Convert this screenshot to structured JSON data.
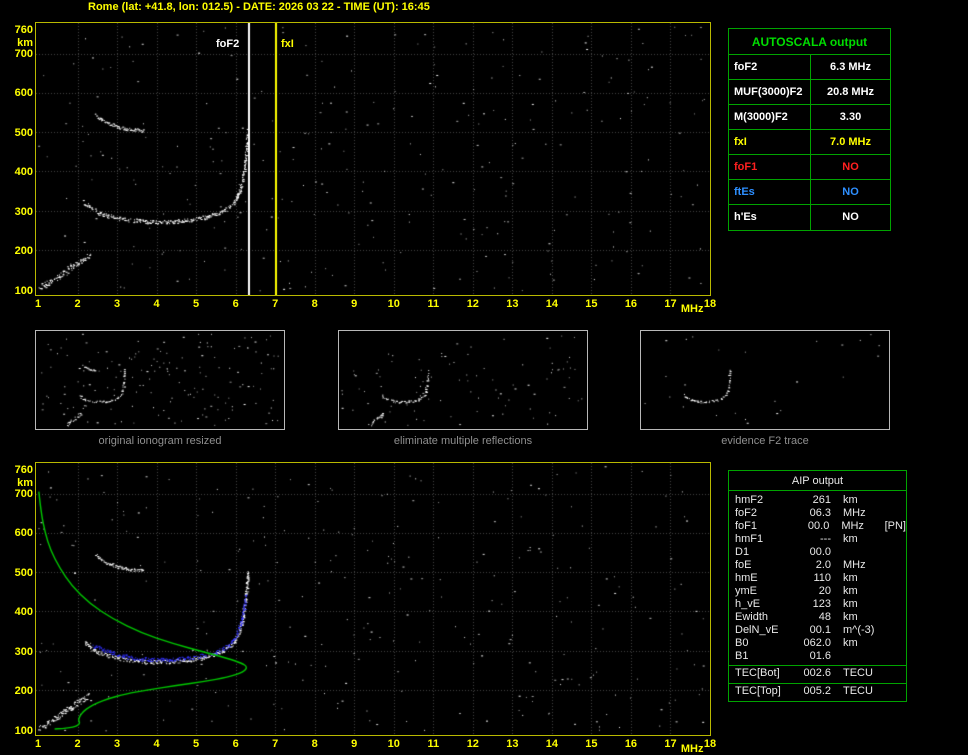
{
  "header": {
    "title": "Rome (lat: +41.8, lon: 012.5) - DATE: 2026 03 22 - TIME (UT): 16:45"
  },
  "autoscala": {
    "title": "AUTOSCALA output",
    "rows": [
      {
        "label": "foF2",
        "value": "6.3 MHz",
        "color": "#ffffff"
      },
      {
        "label": "MUF(3000)F2",
        "value": "20.8 MHz",
        "color": "#ffffff"
      },
      {
        "label": "M(3000)F2",
        "value": "3.30",
        "color": "#ffffff"
      },
      {
        "label": "fxI",
        "value": "7.0 MHz",
        "color": "#ffff00"
      },
      {
        "label": "foF1",
        "value": "NO",
        "color": "#ff2020"
      },
      {
        "label": "ftEs",
        "value": "NO",
        "color": "#2e8fff"
      },
      {
        "label": "h'Es",
        "value": "NO",
        "color": "#ffffff"
      }
    ]
  },
  "thumbnails": [
    {
      "caption": "original ionogram resized"
    },
    {
      "caption": "eliminate multiple reflections"
    },
    {
      "caption": "evidence F2 trace"
    }
  ],
  "aip": {
    "title": "AIP output",
    "rows": [
      {
        "param": "hmF2",
        "value": "261",
        "unit": "km"
      },
      {
        "param": "foF2",
        "value": "06.3",
        "unit": "MHz"
      },
      {
        "param": "foF1",
        "value": "00.0",
        "unit": "MHz",
        "extra": "[PN]"
      },
      {
        "param": "hmF1",
        "value": "---",
        "unit": "km"
      },
      {
        "param": "D1",
        "value": "00.0",
        "unit": ""
      },
      {
        "param": "foE",
        "value": "2.0",
        "unit": "MHz"
      },
      {
        "param": "hmE",
        "value": "110",
        "unit": "km"
      },
      {
        "param": "ymE",
        "value": "20",
        "unit": "km"
      },
      {
        "param": "h_vE",
        "value": "123",
        "unit": "km"
      },
      {
        "param": "Ewidth",
        "value": "48",
        "unit": "km"
      },
      {
        "param": "DelN_vE",
        "value": "00.1",
        "unit": "m^(-3)"
      },
      {
        "param": "B0",
        "value": "062.0",
        "unit": "km"
      },
      {
        "param": "B1",
        "value": "01.6",
        "unit": ""
      },
      {
        "param": "TEC[Bot]",
        "value": "002.6",
        "unit": "TECU",
        "sep_above": true
      },
      {
        "param": "TEC[Top]",
        "value": "005.2",
        "unit": "TECU",
        "sep_above": true
      }
    ]
  },
  "chart_data": {
    "type": "scatter",
    "axes": {
      "xlabel": "MHz",
      "ylabel": "km",
      "xlim": [
        1,
        18
      ],
      "ylim": [
        100,
        760
      ],
      "xticks": [
        1,
        2,
        3,
        4,
        5,
        6,
        7,
        8,
        9,
        10,
        11,
        12,
        13,
        14,
        15,
        16,
        17,
        18
      ],
      "yticks": [
        760,
        700,
        600,
        500,
        400,
        300,
        200,
        100
      ],
      "grid": true
    },
    "traces": {
      "f2_virtual": {
        "color": "#ffffff",
        "thick": 4,
        "points": [
          [
            2.15,
            322
          ],
          [
            2.3,
            308
          ],
          [
            2.5,
            296
          ],
          [
            2.75,
            287
          ],
          [
            3.0,
            281
          ],
          [
            3.3,
            276
          ],
          [
            3.7,
            272
          ],
          [
            4.1,
            271
          ],
          [
            4.5,
            273
          ],
          [
            4.9,
            277
          ],
          [
            5.2,
            283
          ],
          [
            5.5,
            292
          ],
          [
            5.75,
            304
          ],
          [
            5.95,
            322
          ],
          [
            6.08,
            348
          ],
          [
            6.17,
            380
          ],
          [
            6.23,
            420
          ],
          [
            6.27,
            460
          ],
          [
            6.3,
            505
          ]
        ]
      },
      "f2_second_hop": {
        "color": "#f0f0f0",
        "thick": 3,
        "points": [
          [
            2.45,
            545
          ],
          [
            2.6,
            532
          ],
          [
            2.8,
            521
          ],
          [
            3.0,
            514
          ],
          [
            3.2,
            509
          ],
          [
            3.45,
            506
          ],
          [
            3.65,
            504
          ]
        ]
      },
      "es_low": {
        "color": "#ffffff",
        "thick": 6,
        "points": [
          [
            1.02,
            104
          ],
          [
            1.2,
            112
          ],
          [
            1.35,
            122
          ],
          [
            1.5,
            132
          ],
          [
            1.65,
            143
          ],
          [
            1.82,
            155
          ],
          [
            2.0,
            167
          ],
          [
            2.15,
            177
          ],
          [
            2.3,
            186
          ]
        ]
      },
      "f2_restored": {
        "color": "#3030ff",
        "thick": 4,
        "points": [
          [
            2.4,
            312
          ],
          [
            2.8,
            296
          ],
          [
            3.2,
            285
          ],
          [
            3.7,
            278
          ],
          [
            4.2,
            276
          ],
          [
            4.7,
            280
          ],
          [
            5.1,
            286
          ],
          [
            5.5,
            296
          ],
          [
            5.8,
            312
          ],
          [
            6.0,
            336
          ],
          [
            6.12,
            368
          ],
          [
            6.2,
            405
          ],
          [
            6.25,
            440
          ]
        ]
      },
      "density_profile": {
        "color": "#00c800",
        "style": "line",
        "points": [
          [
            1.02,
            705
          ],
          [
            1.08,
            650
          ],
          [
            1.18,
            600
          ],
          [
            1.32,
            555
          ],
          [
            1.55,
            510
          ],
          [
            1.85,
            465
          ],
          [
            2.3,
            420
          ],
          [
            2.9,
            380
          ],
          [
            3.6,
            345
          ],
          [
            4.4,
            318
          ],
          [
            5.2,
            296
          ],
          [
            5.8,
            280
          ],
          [
            6.15,
            268
          ],
          [
            6.3,
            258
          ],
          [
            6.2,
            245
          ],
          [
            5.8,
            232
          ],
          [
            5.2,
            221
          ],
          [
            4.5,
            211
          ],
          [
            3.8,
            200
          ],
          [
            3.2,
            189
          ],
          [
            2.8,
            178
          ],
          [
            2.5,
            167
          ],
          [
            2.3,
            156
          ],
          [
            2.15,
            145
          ],
          [
            2.06,
            133
          ],
          [
            2.02,
            123
          ],
          [
            2.06,
            116
          ],
          [
            2.02,
            110
          ],
          [
            1.9,
            105
          ],
          [
            1.6,
            101
          ],
          [
            1.42,
            100
          ]
        ]
      }
    },
    "plots": [
      {
        "id": "top",
        "markers": [
          {
            "label": "foF2",
            "x": 6.3,
            "color": "#ffffff"
          },
          {
            "label": "fxI",
            "x": 7.0,
            "color": "#ffff00"
          }
        ],
        "traces": [
          "f2_virtual",
          "f2_second_hop",
          "es_low"
        ],
        "noise": 290
      },
      {
        "id": "bottom",
        "markers": [],
        "traces": [
          "f2_virtual",
          "f2_second_hop",
          "es_low",
          "f2_restored",
          "density_profile"
        ],
        "noise": 290
      }
    ],
    "thumbs": [
      {
        "traces": [
          "f2_virtual",
          "f2_second_hop",
          "es_low"
        ],
        "noise": 160
      },
      {
        "traces": [
          "f2_virtual",
          "es_low"
        ],
        "noise": 95
      },
      {
        "traces": [
          "f2_virtual"
        ],
        "noise": 25
      }
    ]
  },
  "colors": {
    "axis": "#ffff00",
    "panel_border": "#00a400",
    "plot_border": "#b9b900"
  }
}
